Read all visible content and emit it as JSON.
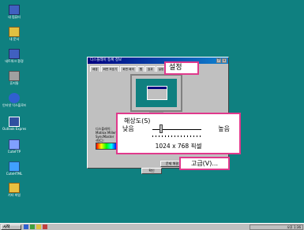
{
  "desktop": {
    "icons": [
      {
        "label": "내 컴퓨터",
        "icon": "my-computer-icon",
        "color": "#4060c0"
      },
      {
        "label": "내 문서",
        "icon": "my-documents-icon",
        "color": "#e0c040"
      },
      {
        "label": "네트워크 환경",
        "icon": "network-icon",
        "color": "#4060c0"
      },
      {
        "label": "휴지통",
        "icon": "recycle-bin-icon",
        "color": "#a0a0a0"
      },
      {
        "label": "인터넷 익스플로러",
        "icon": "internet-explorer-icon",
        "color": "#3060d0"
      },
      {
        "label": "Outlook Express",
        "icon": "outlook-express-icon",
        "color": "#3050a0"
      },
      {
        "label": "CuteFTP",
        "icon": "cuteftp-icon",
        "color": "#80a0ff"
      },
      {
        "label": "CuteHTML",
        "icon": "cutehtml-icon",
        "color": "#40a0ff"
      },
      {
        "label": "기타 파일",
        "icon": "folder-icon",
        "color": "#e8c040"
      }
    ]
  },
  "dialog": {
    "title": "디스플레이 등록 정보",
    "tabs": [
      "배경",
      "화면 보호기",
      "화면 배색",
      "웹",
      "효과",
      "설정"
    ],
    "labels": [
      "디스플레이:",
      "Matrox Millen..",
      "SyncMaster",
      "색(C):"
    ],
    "buttons": {
      "troubleshoot": "문제 해결",
      "ok": "확인",
      "cancel": "취소",
      "apply": "적용"
    }
  },
  "callouts": {
    "settings_tab": "설정",
    "resolution": {
      "title": "해상도(S)",
      "low": "낮음",
      "high": "높음",
      "value": "1024 x 768 픽셀"
    },
    "advanced_button": "고급(V)..."
  },
  "taskbar": {
    "start": "시작",
    "tray": "오후 1:36"
  },
  "colors": {
    "desktop": "#0f8080",
    "highlight": "#e0398c",
    "titlebar": "#000080"
  }
}
